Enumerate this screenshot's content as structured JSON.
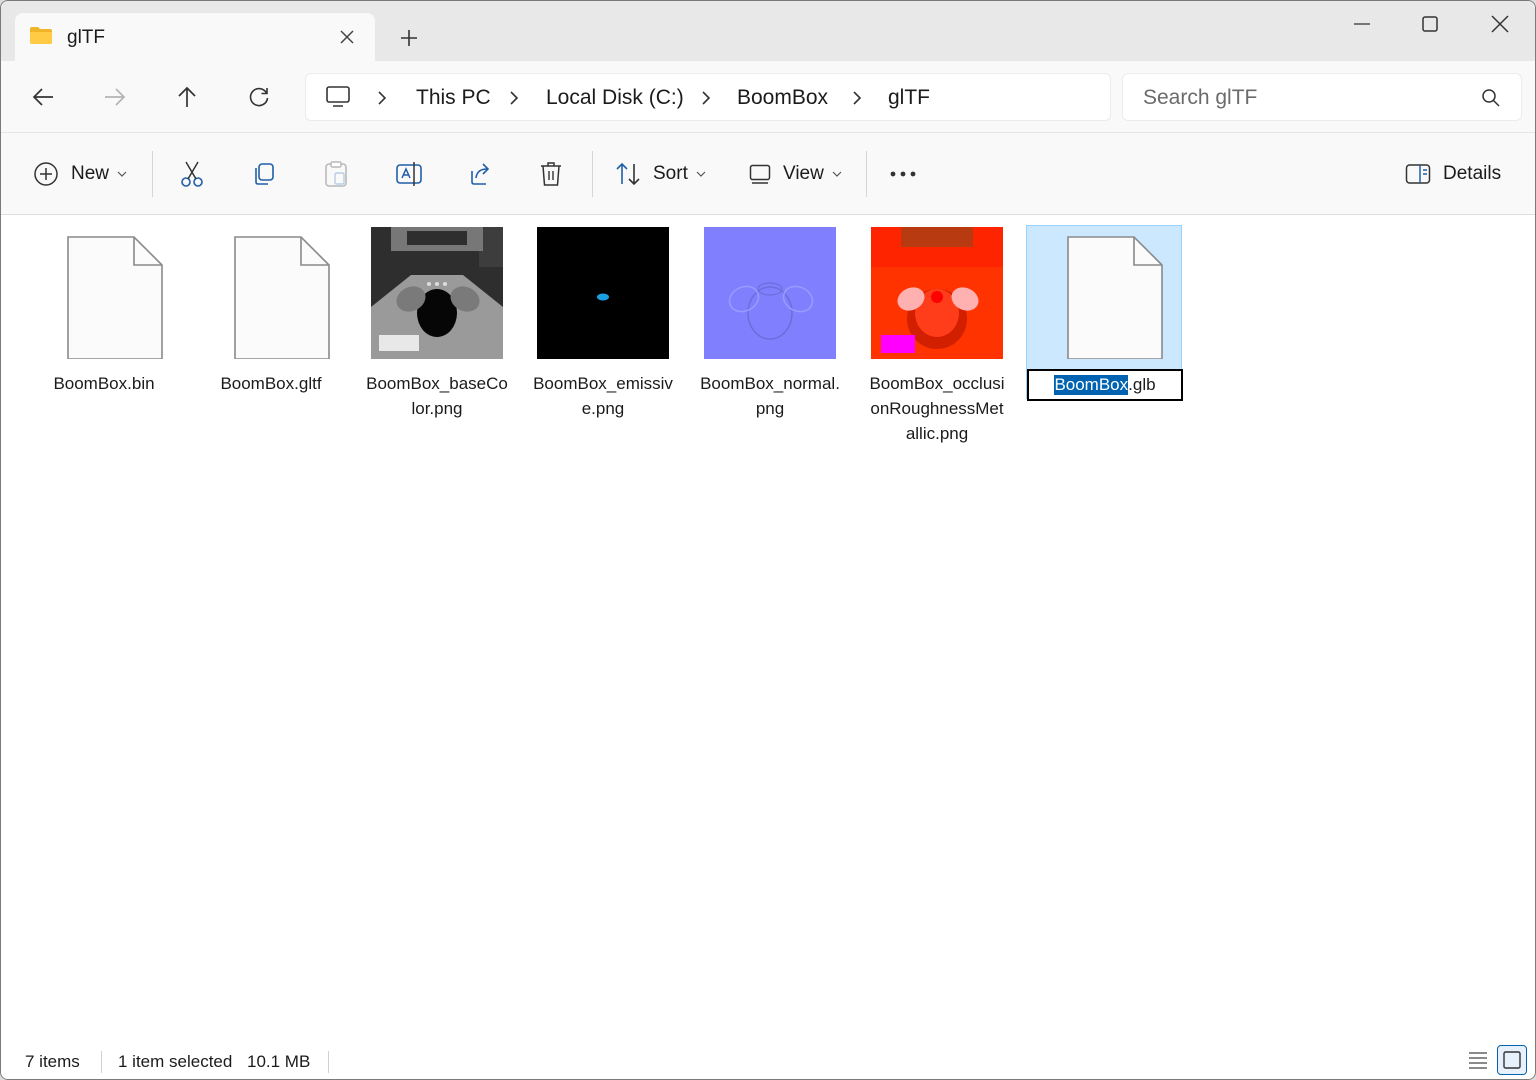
{
  "tab": {
    "title": "glTF",
    "icon": "folder-icon"
  },
  "address": {
    "crumbs": [
      "This PC",
      "Local Disk (C:)",
      "BoomBox",
      "glTF"
    ]
  },
  "search": {
    "placeholder": "Search glTF",
    "value": ""
  },
  "commands": {
    "new_label": "New",
    "sort_label": "Sort",
    "view_label": "View",
    "details_label": "Details"
  },
  "files": [
    {
      "name": "BoomBox.bin",
      "kind": "generic"
    },
    {
      "name": "BoomBox.gltf",
      "kind": "generic"
    },
    {
      "name": "BoomBox_baseColor.png",
      "kind": "basecolor"
    },
    {
      "name": "BoomBox_emissive.png",
      "kind": "emissive"
    },
    {
      "name": "BoomBox_normal.png",
      "kind": "normal"
    },
    {
      "name": "BoomBox_occlusionRoughnessMetallic.png",
      "kind": "orm"
    },
    {
      "name": "BoomBox.glb",
      "kind": "generic",
      "selected": true
    }
  ],
  "rename": {
    "selected_part": "BoomBox",
    "rest_part": ".glb"
  },
  "status": {
    "items_count": "7 items",
    "selected_text": "1 item selected",
    "size_text": "10.1 MB"
  },
  "colors": {
    "accent": "#0063b1",
    "selection_bg": "#cce8ff",
    "folder": "#f8c33a"
  }
}
